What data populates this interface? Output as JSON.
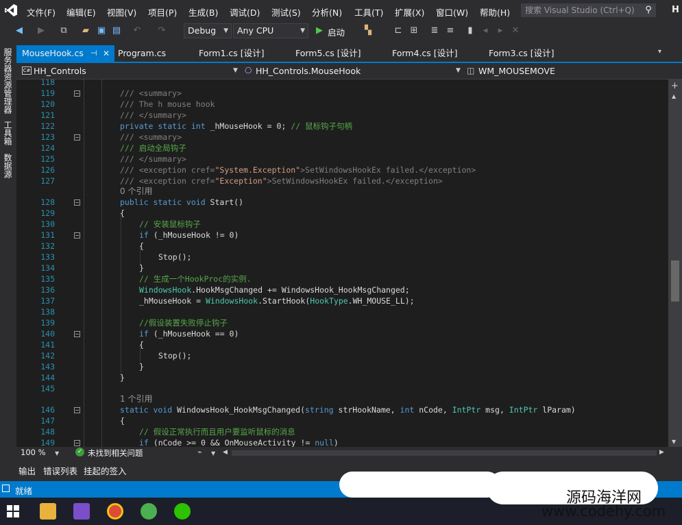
{
  "app": {
    "name": "Visual Studio",
    "user_initial": "H",
    "accent": "#007acc"
  },
  "menu": [
    "文件(F)",
    "编辑(E)",
    "视图(V)",
    "项目(P)",
    "生成(B)",
    "调试(D)",
    "测试(S)",
    "分析(N)",
    "工具(T)",
    "扩展(X)",
    "窗口(W)",
    "帮助(H)"
  ],
  "search": {
    "placeholder": "搜索 Visual Studio (Ctrl+Q)"
  },
  "toolbar": {
    "config": "Debug",
    "platform": "Any CPU",
    "start_label": "启动"
  },
  "side_panels": [
    "服务器资源管理器",
    "工具箱",
    "数据源"
  ],
  "tabs": [
    {
      "label": "MouseHook.cs",
      "active": true
    },
    {
      "label": "Program.cs"
    },
    {
      "label": "Form1.cs [设计]"
    },
    {
      "label": "Form5.cs [设计]"
    },
    {
      "label": "Form4.cs [设计]"
    },
    {
      "label": "Form3.cs [设计]"
    }
  ],
  "nav": {
    "project": "HH_Controls",
    "type": "HH_Controls.MouseHook",
    "member": "WM_MOUSEMOVE"
  },
  "code": {
    "line_numbers": [
      "118",
      "119",
      "120",
      "121",
      "122",
      "123",
      "124",
      "125",
      "126",
      "127",
      "128",
      "129",
      "130",
      "131",
      "132",
      "133",
      "134",
      "135",
      "136",
      "137",
      "138",
      "139",
      "140",
      "141",
      "142",
      "143",
      "144",
      "145",
      "146",
      "147",
      "148",
      "149"
    ],
    "refs_0": "0 个引用",
    "refs_1": "1 个引用",
    "l119": "/// <summary>",
    "l120": "/// The h mouse hook",
    "l121": "/// </summary>",
    "l122_a": "private static ",
    "l122_b": "int",
    "l122_c": " _hMouseHook = 0; ",
    "l122_d": "// 鼠标钩子句柄",
    "l123": "/// <summary>",
    "l124": "/// 启动全局钩子",
    "l125": "/// </summary>",
    "l126_a": "/// <exception cref=",
    "l126_b": "\"System.Exception\"",
    "l126_c": ">SetWindowsHookEx failed.</exception>",
    "l127_a": "/// <exception cref=",
    "l127_b": "\"Exception\"",
    "l127_c": ">SetWindowsHookEx failed.</exception>",
    "l128_a": "public static void",
    "l128_b": " Start()",
    "l129": "{",
    "l130": "// 安装鼠标钩子",
    "l131_a": "if",
    "l131_b": " (_hMouseHook != 0)",
    "l132": "{",
    "l133": "Stop();",
    "l134": "}",
    "l135": "// 生成一个HookProc的实例.",
    "l136_a": "WindowsHook",
    "l136_b": ".HookMsgChanged += WindowsHook_HookMsgChanged;",
    "l137_a": "_hMouseHook = ",
    "l137_b": "WindowsHook",
    "l137_c": ".StartHook(",
    "l137_d": "HookType",
    "l137_e": ".WH_MOUSE_LL);",
    "l139": "//假设装置失败停止钩子",
    "l140_a": "if",
    "l140_b": " (_hMouseHook == 0)",
    "l141": "{",
    "l142": "Stop();",
    "l143": "}",
    "l144": "}",
    "l146_a": "static void",
    "l146_b": " WindowsHook_HookMsgChanged(",
    "l146_c": "string",
    "l146_d": " strHookName, ",
    "l146_e": "int",
    "l146_f": " nCode, ",
    "l146_g": "IntPtr",
    "l146_h": " msg, ",
    "l146_i": "IntPtr",
    "l146_j": " lParam)",
    "l147": "{",
    "l148": "// 假设正常执行而且用户要监听鼠标的消息",
    "l149_a": "if",
    "l149_b": " (nCode >= 0 && OnMouseActivity != ",
    "l149_c": "null",
    "l149_d": ")"
  },
  "editor_status": {
    "zoom": "100 %",
    "issues": "未找到相关问题"
  },
  "output_tabs": [
    "输出",
    "错误列表",
    "挂起的签入"
  ],
  "status": {
    "text": "就绪"
  },
  "watermark": {
    "line1": "源码海洋网",
    "line2": "www.codehy.com"
  }
}
